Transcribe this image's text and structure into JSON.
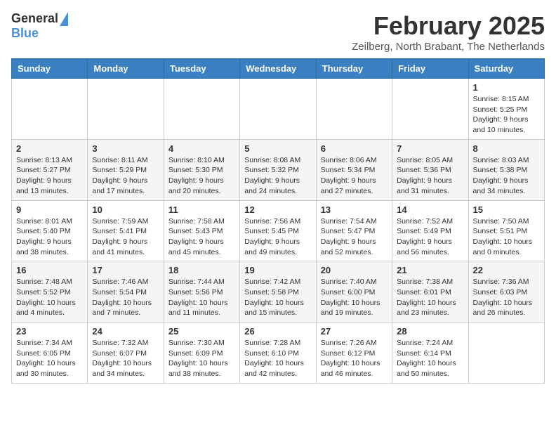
{
  "header": {
    "logo_general": "General",
    "logo_blue": "Blue",
    "month_title": "February 2025",
    "subtitle": "Zeilberg, North Brabant, The Netherlands"
  },
  "days_of_week": [
    "Sunday",
    "Monday",
    "Tuesday",
    "Wednesday",
    "Thursday",
    "Friday",
    "Saturday"
  ],
  "weeks": [
    {
      "days": [
        {
          "num": "",
          "info": ""
        },
        {
          "num": "",
          "info": ""
        },
        {
          "num": "",
          "info": ""
        },
        {
          "num": "",
          "info": ""
        },
        {
          "num": "",
          "info": ""
        },
        {
          "num": "",
          "info": ""
        },
        {
          "num": "1",
          "info": "Sunrise: 8:15 AM\nSunset: 5:25 PM\nDaylight: 9 hours and 10 minutes."
        }
      ]
    },
    {
      "days": [
        {
          "num": "2",
          "info": "Sunrise: 8:13 AM\nSunset: 5:27 PM\nDaylight: 9 hours and 13 minutes."
        },
        {
          "num": "3",
          "info": "Sunrise: 8:11 AM\nSunset: 5:29 PM\nDaylight: 9 hours and 17 minutes."
        },
        {
          "num": "4",
          "info": "Sunrise: 8:10 AM\nSunset: 5:30 PM\nDaylight: 9 hours and 20 minutes."
        },
        {
          "num": "5",
          "info": "Sunrise: 8:08 AM\nSunset: 5:32 PM\nDaylight: 9 hours and 24 minutes."
        },
        {
          "num": "6",
          "info": "Sunrise: 8:06 AM\nSunset: 5:34 PM\nDaylight: 9 hours and 27 minutes."
        },
        {
          "num": "7",
          "info": "Sunrise: 8:05 AM\nSunset: 5:36 PM\nDaylight: 9 hours and 31 minutes."
        },
        {
          "num": "8",
          "info": "Sunrise: 8:03 AM\nSunset: 5:38 PM\nDaylight: 9 hours and 34 minutes."
        }
      ]
    },
    {
      "days": [
        {
          "num": "9",
          "info": "Sunrise: 8:01 AM\nSunset: 5:40 PM\nDaylight: 9 hours and 38 minutes."
        },
        {
          "num": "10",
          "info": "Sunrise: 7:59 AM\nSunset: 5:41 PM\nDaylight: 9 hours and 41 minutes."
        },
        {
          "num": "11",
          "info": "Sunrise: 7:58 AM\nSunset: 5:43 PM\nDaylight: 9 hours and 45 minutes."
        },
        {
          "num": "12",
          "info": "Sunrise: 7:56 AM\nSunset: 5:45 PM\nDaylight: 9 hours and 49 minutes."
        },
        {
          "num": "13",
          "info": "Sunrise: 7:54 AM\nSunset: 5:47 PM\nDaylight: 9 hours and 52 minutes."
        },
        {
          "num": "14",
          "info": "Sunrise: 7:52 AM\nSunset: 5:49 PM\nDaylight: 9 hours and 56 minutes."
        },
        {
          "num": "15",
          "info": "Sunrise: 7:50 AM\nSunset: 5:51 PM\nDaylight: 10 hours and 0 minutes."
        }
      ]
    },
    {
      "days": [
        {
          "num": "16",
          "info": "Sunrise: 7:48 AM\nSunset: 5:52 PM\nDaylight: 10 hours and 4 minutes."
        },
        {
          "num": "17",
          "info": "Sunrise: 7:46 AM\nSunset: 5:54 PM\nDaylight: 10 hours and 7 minutes."
        },
        {
          "num": "18",
          "info": "Sunrise: 7:44 AM\nSunset: 5:56 PM\nDaylight: 10 hours and 11 minutes."
        },
        {
          "num": "19",
          "info": "Sunrise: 7:42 AM\nSunset: 5:58 PM\nDaylight: 10 hours and 15 minutes."
        },
        {
          "num": "20",
          "info": "Sunrise: 7:40 AM\nSunset: 6:00 PM\nDaylight: 10 hours and 19 minutes."
        },
        {
          "num": "21",
          "info": "Sunrise: 7:38 AM\nSunset: 6:01 PM\nDaylight: 10 hours and 23 minutes."
        },
        {
          "num": "22",
          "info": "Sunrise: 7:36 AM\nSunset: 6:03 PM\nDaylight: 10 hours and 26 minutes."
        }
      ]
    },
    {
      "days": [
        {
          "num": "23",
          "info": "Sunrise: 7:34 AM\nSunset: 6:05 PM\nDaylight: 10 hours and 30 minutes."
        },
        {
          "num": "24",
          "info": "Sunrise: 7:32 AM\nSunset: 6:07 PM\nDaylight: 10 hours and 34 minutes."
        },
        {
          "num": "25",
          "info": "Sunrise: 7:30 AM\nSunset: 6:09 PM\nDaylight: 10 hours and 38 minutes."
        },
        {
          "num": "26",
          "info": "Sunrise: 7:28 AM\nSunset: 6:10 PM\nDaylight: 10 hours and 42 minutes."
        },
        {
          "num": "27",
          "info": "Sunrise: 7:26 AM\nSunset: 6:12 PM\nDaylight: 10 hours and 46 minutes."
        },
        {
          "num": "28",
          "info": "Sunrise: 7:24 AM\nSunset: 6:14 PM\nDaylight: 10 hours and 50 minutes."
        },
        {
          "num": "",
          "info": ""
        }
      ]
    }
  ]
}
